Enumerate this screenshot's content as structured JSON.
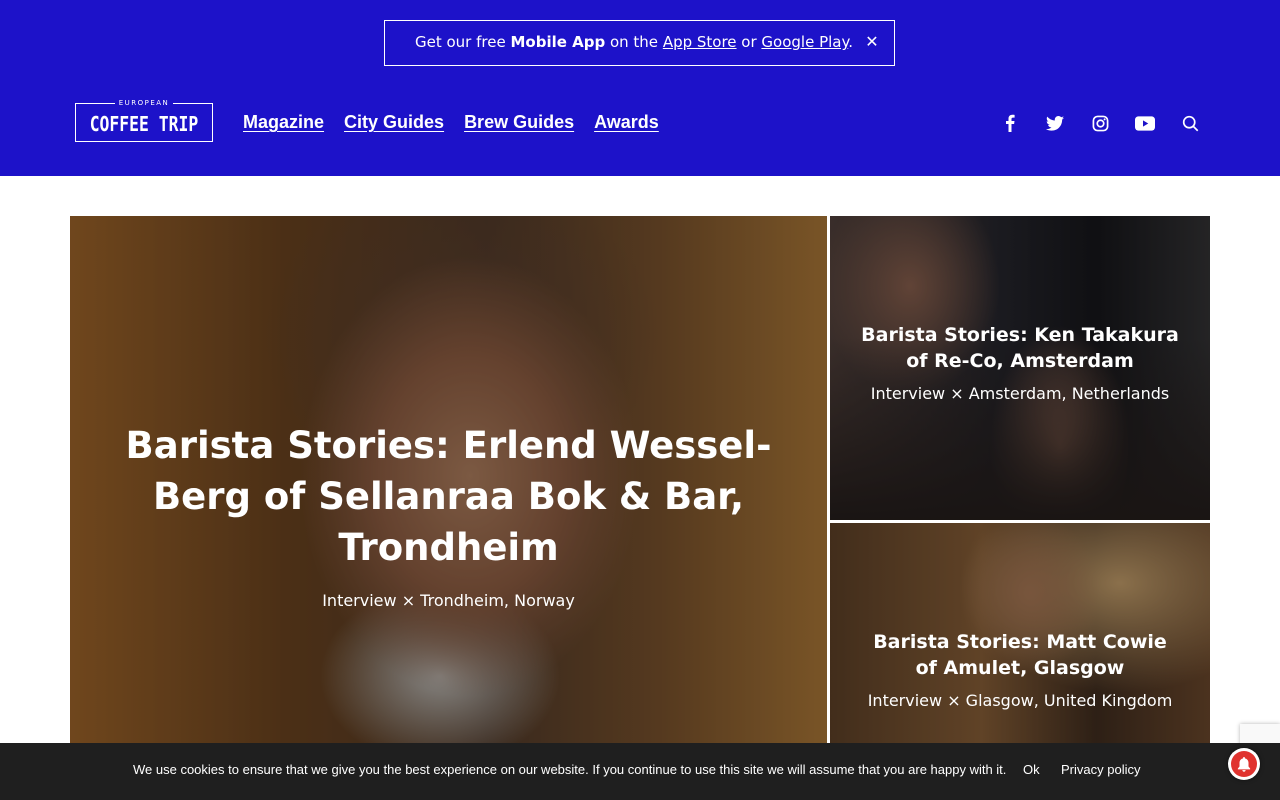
{
  "banner": {
    "prefix": "Get our free ",
    "app_bold": "Mobile App",
    "middle": " on the ",
    "app_store": "App Store",
    "or": " or ",
    "google_play": "Google Play",
    "suffix": ".",
    "close": "✕"
  },
  "logo": {
    "small": "EUROPEAN",
    "big": "COFFEE TRIP"
  },
  "nav": [
    "Magazine",
    "City Guides",
    "Brew Guides",
    "Awards"
  ],
  "social_icons": [
    "facebook-icon",
    "twitter-icon",
    "instagram-icon",
    "youtube-icon",
    "search-icon"
  ],
  "hero": {
    "main": {
      "title": "Barista Stories: Erlend Wessel-Berg of Sellanraa Bok & Bar, Trondheim",
      "meta": "Interview × Trondheim, Norway"
    },
    "side": [
      {
        "title": "Barista Stories: Ken Takakura of Re-Co, Amsterdam",
        "meta": "Interview × Amsterdam, Netherlands"
      },
      {
        "title": "Barista Stories: Matt Cowie of Amulet, Glasgow",
        "meta": "Interview × Glasgow, United Kingdom"
      }
    ]
  },
  "cookie": {
    "message": "We use cookies to ensure that we give you the best experience on our website. If you continue to use this site we will assume that you are happy with it.",
    "ok": "Ok",
    "privacy": "Privacy policy"
  },
  "colors": {
    "brand": "#1d12c9",
    "cookie_bg": "#1f1f1f",
    "notification": "#e0332f"
  }
}
